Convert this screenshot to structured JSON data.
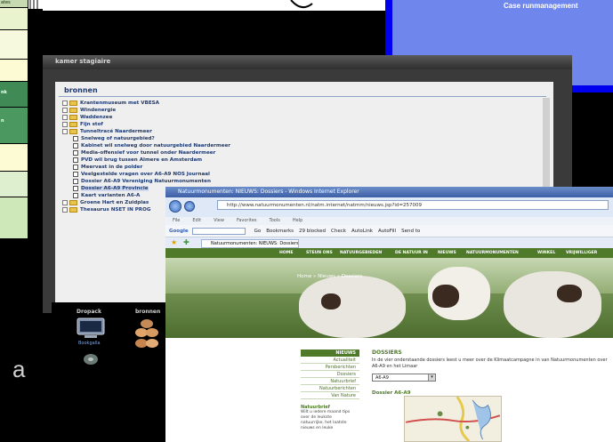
{
  "slide": {
    "blue_title": "Case runmanagement",
    "left_table_cells": [
      "ates",
      "",
      "",
      "",
      "nk",
      "n",
      "",
      "",
      ""
    ],
    "faint_letter": "a"
  },
  "kamer_window": {
    "title": "kamer stagiaire",
    "panel_heading": "bronnen",
    "tree": [
      {
        "label": "Krantenmuseum met VBESA",
        "kind": "folder"
      },
      {
        "label": "Windenergie",
        "kind": "folder"
      },
      {
        "label": "Waddenzee",
        "kind": "folder"
      },
      {
        "label": "Fijn stof",
        "kind": "folder"
      },
      {
        "label": "Tunneltracé Naardermeer",
        "kind": "folder"
      },
      {
        "label": "Snelweg of natuurgebied?",
        "kind": "doc"
      },
      {
        "label": "Kabinet wil snelweg door natuurgebied Naardermeer",
        "kind": "doc"
      },
      {
        "label": "Media-offensief voor tunnel onder Naardermeer",
        "kind": "doc"
      },
      {
        "label": "PVD wil brug tussen Almere en Amsterdam",
        "kind": "doc"
      },
      {
        "label": "Meervast in de polder",
        "kind": "doc"
      },
      {
        "label": "Veelgestelde vragen over A6-A9 NOS Journaal",
        "kind": "doc"
      },
      {
        "label": "Dossier A6-A9 Vereniging Natuurmonumenten",
        "kind": "doc"
      },
      {
        "label": "Dossier A6-A9 Provincie",
        "kind": "doc",
        "selected": true
      },
      {
        "label": "Kaart varianten A6-A",
        "kind": "doc"
      },
      {
        "label": "Groene Hart en Zuidplas",
        "kind": "folder"
      },
      {
        "label": "Thesaurus NSET IN PROG",
        "kind": "folder"
      }
    ],
    "dock": {
      "label_left": "Dropack",
      "label_right": "bronnen",
      "sub_label": "Bookgalla"
    }
  },
  "browser": {
    "window_title": "Natuurmonumenten: NIEUWS: Dossiers - Windows Internet Explorer",
    "address": "http://www.natuurmonumenten.nl/natm.internet/natmm/nieuws.jsp?id=257009",
    "menu": [
      "File",
      "Edit",
      "View",
      "Favorites",
      "Tools",
      "Help"
    ],
    "google_toolbar": {
      "logo": "Google",
      "go": "Go",
      "bookmarks": "Bookmarks",
      "blocked": "29 blocked",
      "check": "Check",
      "autolink": "AutoLink",
      "autofill": "AutoFill",
      "send": "Send to"
    },
    "tab_title": "Natuurmonumenten: NIEUWS: Dossiers",
    "site_nav": [
      "HOME",
      "STEUN ONS",
      "NATUURGEBIEDEN",
      "DE NATUUR IN",
      "NIEUWS",
      "NATUURMONUMENTEN",
      "WINKEL",
      "VRIJWILLIGER"
    ],
    "breadcrumb": "Home » Nieuws » Dossiers",
    "side_menu": {
      "heading": "NIEUWS",
      "items": [
        "Actualiteit",
        "Persberichten",
        "Dossiers",
        "Natuurbrief",
        "Natuurberichten",
        "Van Nature"
      ],
      "box_title": "Natuurbrief",
      "box_text": "Wilt u iedere maand tips over de leukste natuurrijke, het laatste nieuws en leuke"
    },
    "content": {
      "title": "DOSSIERS",
      "intro": "In de vier onderstaande dossiers leest u meer over de Klimaatcampagne in van Natuurmonumenten over A6-A9 en het Limaar",
      "select_value": "A6-A9",
      "sub_title": "Dossier A6-A9"
    }
  },
  "colors": {
    "slide_blue_border": "#0000ee",
    "slide_blue_fill": "#6f86ec",
    "site_green": "#4e7a2a",
    "tree_text": "#1f3a70"
  }
}
